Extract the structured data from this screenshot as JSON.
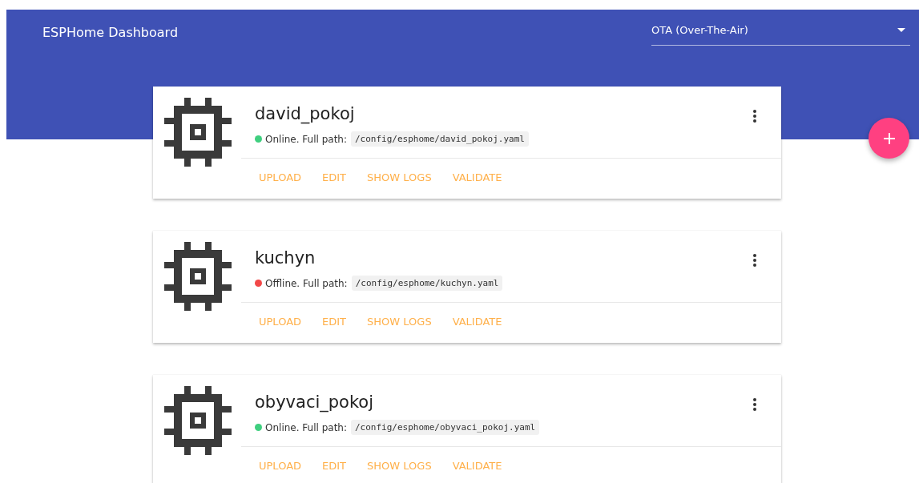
{
  "header": {
    "title": "ESPHome Dashboard",
    "upload_target": {
      "value": "OTA (Over-The-Air)"
    }
  },
  "devices": [
    {
      "name": "david_pokoj",
      "online": true,
      "status_text": "Online. Full path:",
      "path": "/config/esphome/david_pokoj.yaml",
      "actions": [
        "UPLOAD",
        "EDIT",
        "SHOW LOGS",
        "VALIDATE"
      ]
    },
    {
      "name": "kuchyn",
      "online": false,
      "status_text": "Offline. Full path:",
      "path": "/config/esphome/kuchyn.yaml",
      "actions": [
        "UPLOAD",
        "EDIT",
        "SHOW LOGS",
        "VALIDATE"
      ]
    },
    {
      "name": "obyvaci_pokoj",
      "online": true,
      "status_text": "Online. Full path:",
      "path": "/config/esphome/obyvaci_pokoj.yaml",
      "actions": [
        "UPLOAD",
        "EDIT",
        "SHOW LOGS",
        "VALIDATE"
      ]
    }
  ]
}
